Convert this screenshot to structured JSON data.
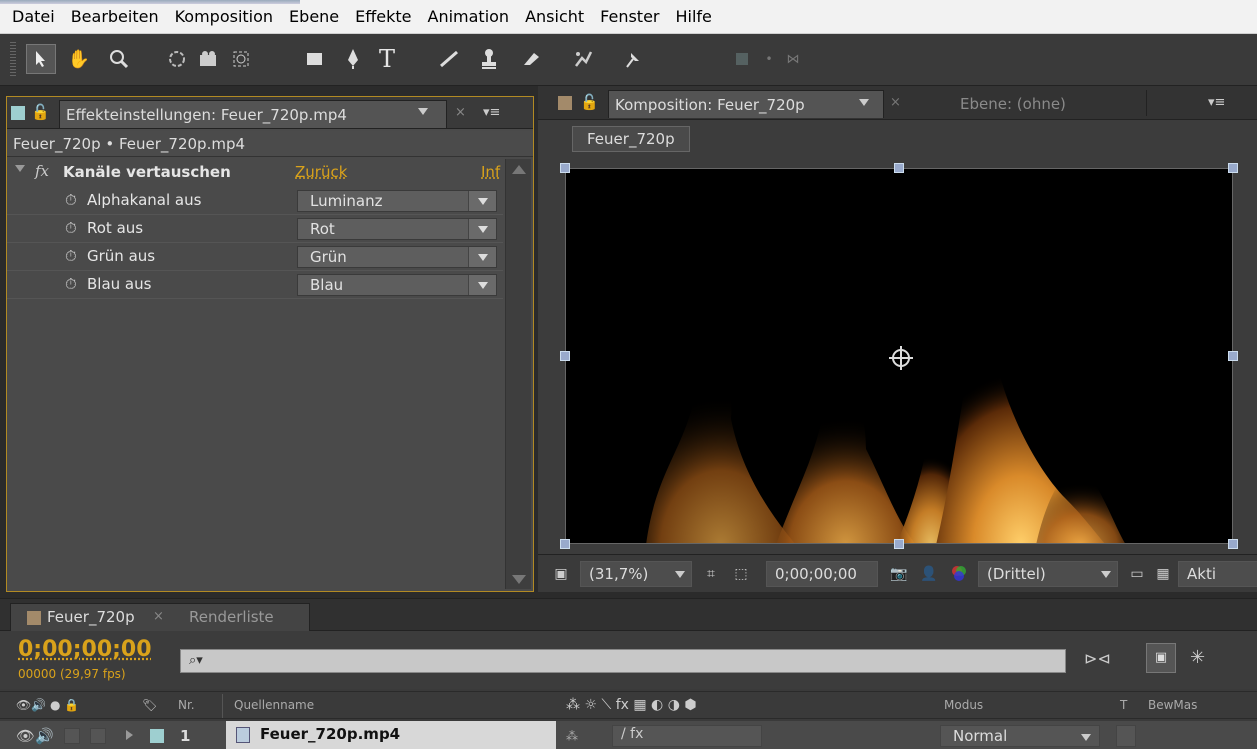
{
  "menu": [
    "Datei",
    "Bearbeiten",
    "Komposition",
    "Ebene",
    "Effekte",
    "Animation",
    "Ansicht",
    "Fenster",
    "Hilfe"
  ],
  "effects_panel": {
    "tab_title": "Effekteinstellungen: Feuer_720p.mp4",
    "breadcrumb": "Feuer_720p • Feuer_720p.mp4",
    "effect_name": "Kanäle vertauschen",
    "reset_label": "Zurück",
    "info_label": "Inf",
    "properties": [
      {
        "label": "Alphakanal aus",
        "value": "Luminanz"
      },
      {
        "label": "Rot aus",
        "value": "Rot"
      },
      {
        "label": "Grün aus",
        "value": "Grün"
      },
      {
        "label": "Blau aus",
        "value": "Blau"
      }
    ]
  },
  "comp_panel": {
    "tab_title": "Komposition: Feuer_720p",
    "layer_tab": "Ebene: (ohne)",
    "comp_name_label": "Feuer_720p",
    "zoom": "(31,7%)",
    "timecode": "0;00;00;00",
    "resolution": "(Drittel)",
    "active_camera_partial": "Akti"
  },
  "timeline": {
    "comp_tab": "Feuer_720p",
    "render_tab": "Renderliste",
    "timecode": "0;00;00;00",
    "frame_info": "00000 (29,97 fps)",
    "search_placeholder": "⌕▾",
    "headers": {
      "nr": "Nr.",
      "source": "Quellenname",
      "mode": "Modus",
      "t": "T",
      "trkmat": "BewMas"
    },
    "layer": {
      "index": "1",
      "name": "Feuer_720p.mp4",
      "mode": "Normal"
    }
  },
  "colors": {
    "accent_orange": "#d9a21b",
    "panel_bg": "#4a4a4a",
    "highlight_border": "#b28a23"
  }
}
